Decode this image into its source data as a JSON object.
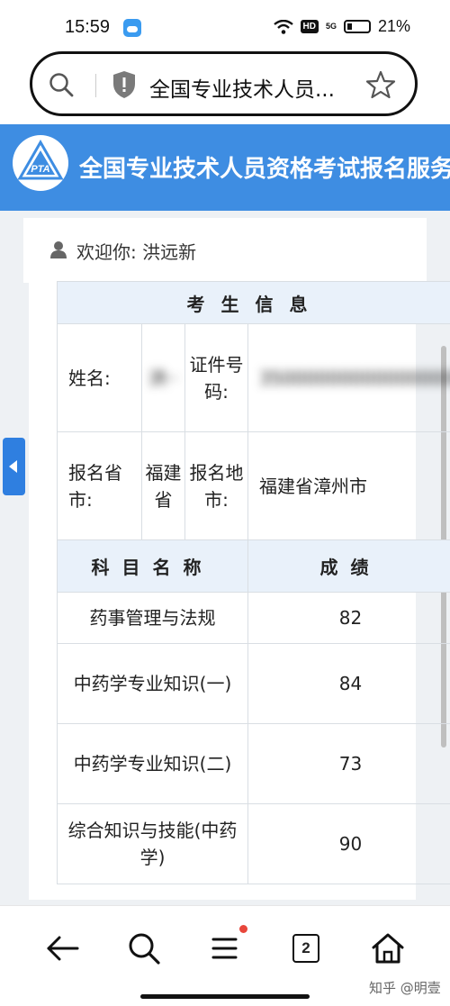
{
  "status_bar": {
    "time": "15:59",
    "battery": "21%",
    "hd": "HD",
    "network": "5G"
  },
  "address_bar": {
    "url_title": "全国专业技术人员..."
  },
  "site": {
    "title": "全国专业技术人员资格考试报名服务平台",
    "logo_text": "PTA"
  },
  "welcome": {
    "label": "欢迎你:",
    "name": "洪远新"
  },
  "table": {
    "header": "考生信息",
    "name_label": "姓名:",
    "name_value": "洪··",
    "id_label": "证件号码:",
    "id_value": "350000000000000000",
    "province_label": "报名省市:",
    "province_value": "福建省",
    "city_label": "报名地市:",
    "city_value": "福建省漳州市",
    "subject_header": "科目名称",
    "score_header": "成绩",
    "rows": [
      {
        "subject": "药事管理与法规",
        "score": "82"
      },
      {
        "subject": "中药学专业知识(一)",
        "score": "84"
      },
      {
        "subject": "中药学专业知识(二)",
        "score": "73"
      },
      {
        "subject": "综合知识与技能(中药学)",
        "score": "90"
      }
    ]
  },
  "bottom_nav": {
    "tab_count": "2",
    "watermark": "知乎 @明壹"
  },
  "colors": {
    "brand_blue": "#3e8de2",
    "header_bg": "#e9f1fa",
    "badge_red": "#e8463b"
  }
}
